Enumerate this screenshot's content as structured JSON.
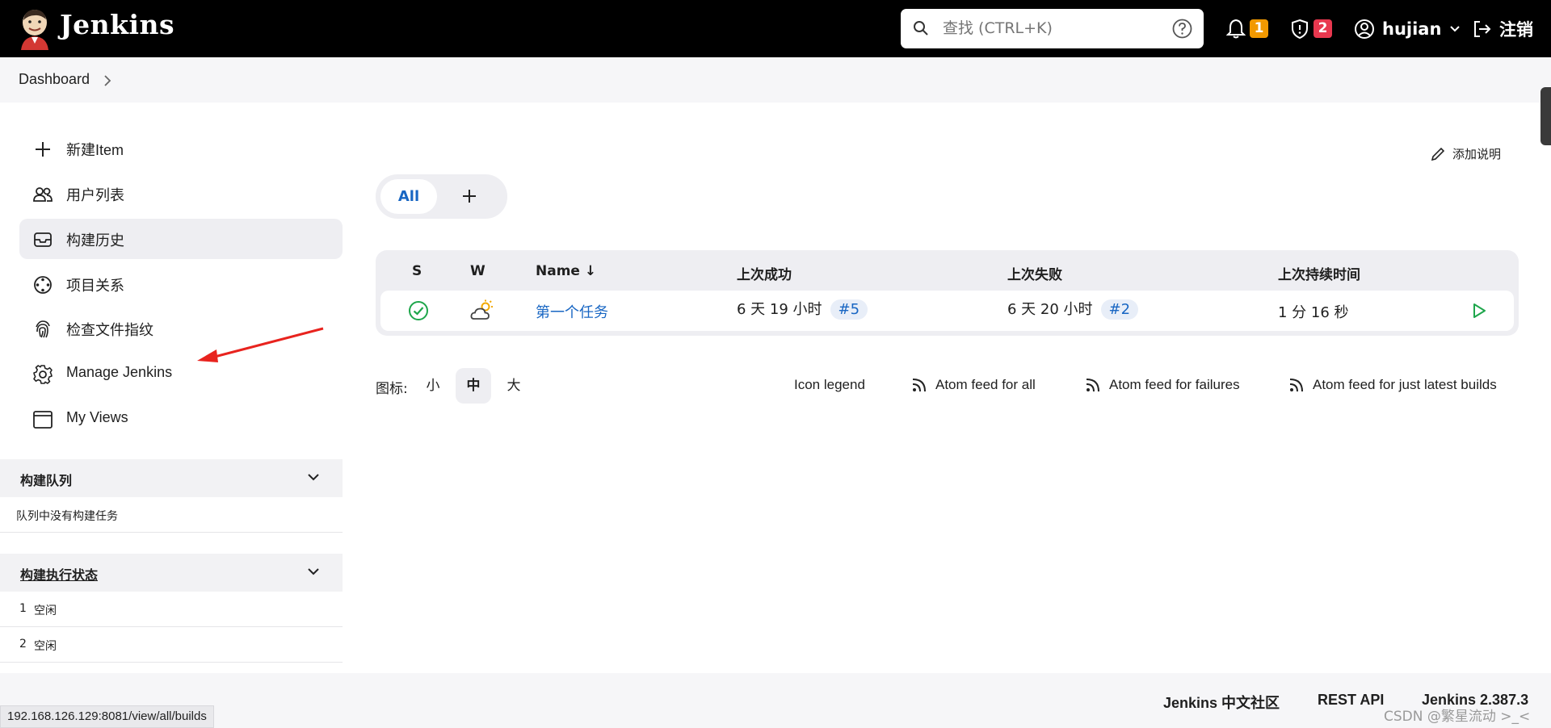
{
  "header": {
    "brand": "Jenkins",
    "search_placeholder": "查找 (CTRL+K)",
    "notifications_count": "1",
    "security_count": "2",
    "user_name": "hujian",
    "logout_label": "注销",
    "colors": {
      "bar": "#000000",
      "notification_badge": "#f29900",
      "security_badge": "#e8384f"
    }
  },
  "breadcrumb": {
    "items": [
      "Dashboard"
    ]
  },
  "sidebar": {
    "items": [
      {
        "label": "新建Item",
        "icon": "plus-icon"
      },
      {
        "label": "用户列表",
        "icon": "users-icon"
      },
      {
        "label": "构建历史",
        "icon": "inbox-icon"
      },
      {
        "label": "项目关系",
        "icon": "relations-icon"
      },
      {
        "label": "检查文件指纹",
        "icon": "fingerprint-icon"
      },
      {
        "label": "Manage Jenkins",
        "icon": "gear-icon"
      },
      {
        "label": "My Views",
        "icon": "window-icon"
      }
    ],
    "active_index": 2,
    "build_queue": {
      "title": "构建队列",
      "empty_text": "队列中没有构建任务"
    },
    "executors": {
      "title": "构建执行状态",
      "rows": [
        {
          "number": "1",
          "status": "空闲"
        },
        {
          "number": "2",
          "status": "空闲"
        }
      ]
    }
  },
  "main": {
    "add_description": "添加说明",
    "tabs": {
      "all_label": "All"
    },
    "table": {
      "headers": {
        "s": "S",
        "w": "W",
        "name": "Name ↓",
        "last_success": "上次成功",
        "last_failure": "上次失败",
        "last_duration": "上次持续时间"
      },
      "rows": [
        {
          "name": "第一个任务",
          "last_success_time": "6 天 19 小时",
          "last_success_build": "#5",
          "last_failure_time": "6 天 20 小时",
          "last_failure_build": "#2",
          "last_duration": "1 分 16 秒"
        }
      ]
    },
    "icon_size": {
      "label": "图标:",
      "small": "小",
      "medium": "中",
      "large": "大",
      "selected": "中"
    },
    "links": {
      "icon_legend": "Icon legend",
      "feed_all": "Atom feed for all",
      "feed_failures": "Atom feed for failures",
      "feed_latest": "Atom feed for just latest builds"
    }
  },
  "footer": {
    "community": "Jenkins 中文社区",
    "rest_api": "REST API",
    "version": "Jenkins 2.387.3"
  },
  "statusbar": {
    "url": "192.168.126.129:8081/view/all/builds"
  },
  "watermark": "CSDN @繁星流动 >_<"
}
